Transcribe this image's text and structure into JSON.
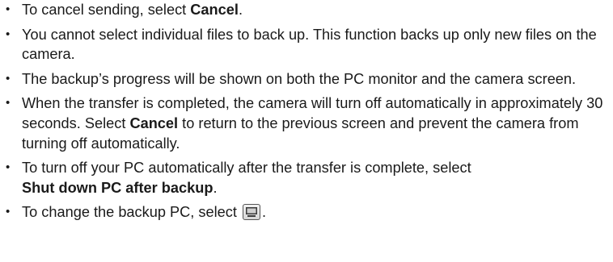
{
  "notes": [
    {
      "before": "To cancel sending, select ",
      "bold": "Cancel",
      "after": "."
    },
    {
      "text": "You cannot select individual files to back up. This function backs up only new files on the camera."
    },
    {
      "text": "The backup’s progress will be shown on both the PC monitor and the camera screen."
    },
    {
      "before": "When the transfer is completed, the camera will turn off automatically in approximately 30 seconds. Select ",
      "bold": "Cancel",
      "after": " to return to the previous screen and prevent the camera from turning off automatically."
    },
    {
      "before": "To turn off your PC automatically after the transfer is complete, select",
      "bold": "Shut down PC after backup",
      "after": "."
    },
    {
      "before": "To change the backup PC, select ",
      "icon": "pc-monitor-icon",
      "after": "."
    }
  ]
}
